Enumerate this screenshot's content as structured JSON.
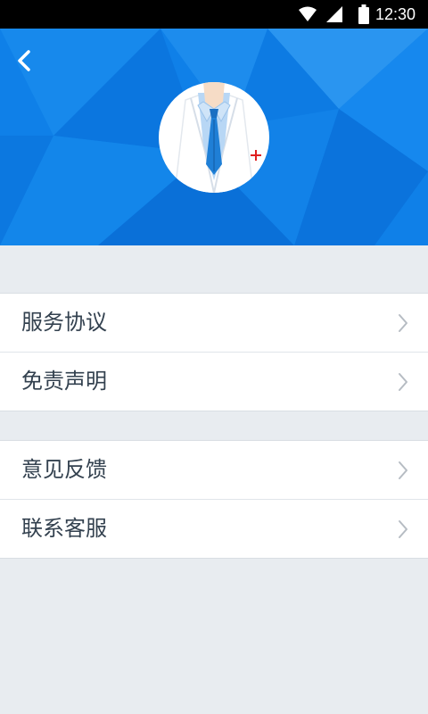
{
  "status_bar": {
    "time": "12:30",
    "icons": [
      "wifi-icon",
      "signal-icon",
      "battery-icon"
    ]
  },
  "header": {
    "back_icon": "chevron-left-icon",
    "avatar_icon": "doctor-suit-icon",
    "colors": {
      "background": "#0f80e8",
      "dark": "#0a6fd6",
      "light": "#2a95f0"
    }
  },
  "menu": {
    "group1": [
      {
        "label": "服务协议",
        "icon": "chevron-right-icon"
      },
      {
        "label": "免责声明",
        "icon": "chevron-right-icon"
      }
    ],
    "group2": [
      {
        "label": "意见反馈",
        "icon": "chevron-right-icon"
      },
      {
        "label": "联系客服",
        "icon": "chevron-right-icon"
      }
    ]
  }
}
